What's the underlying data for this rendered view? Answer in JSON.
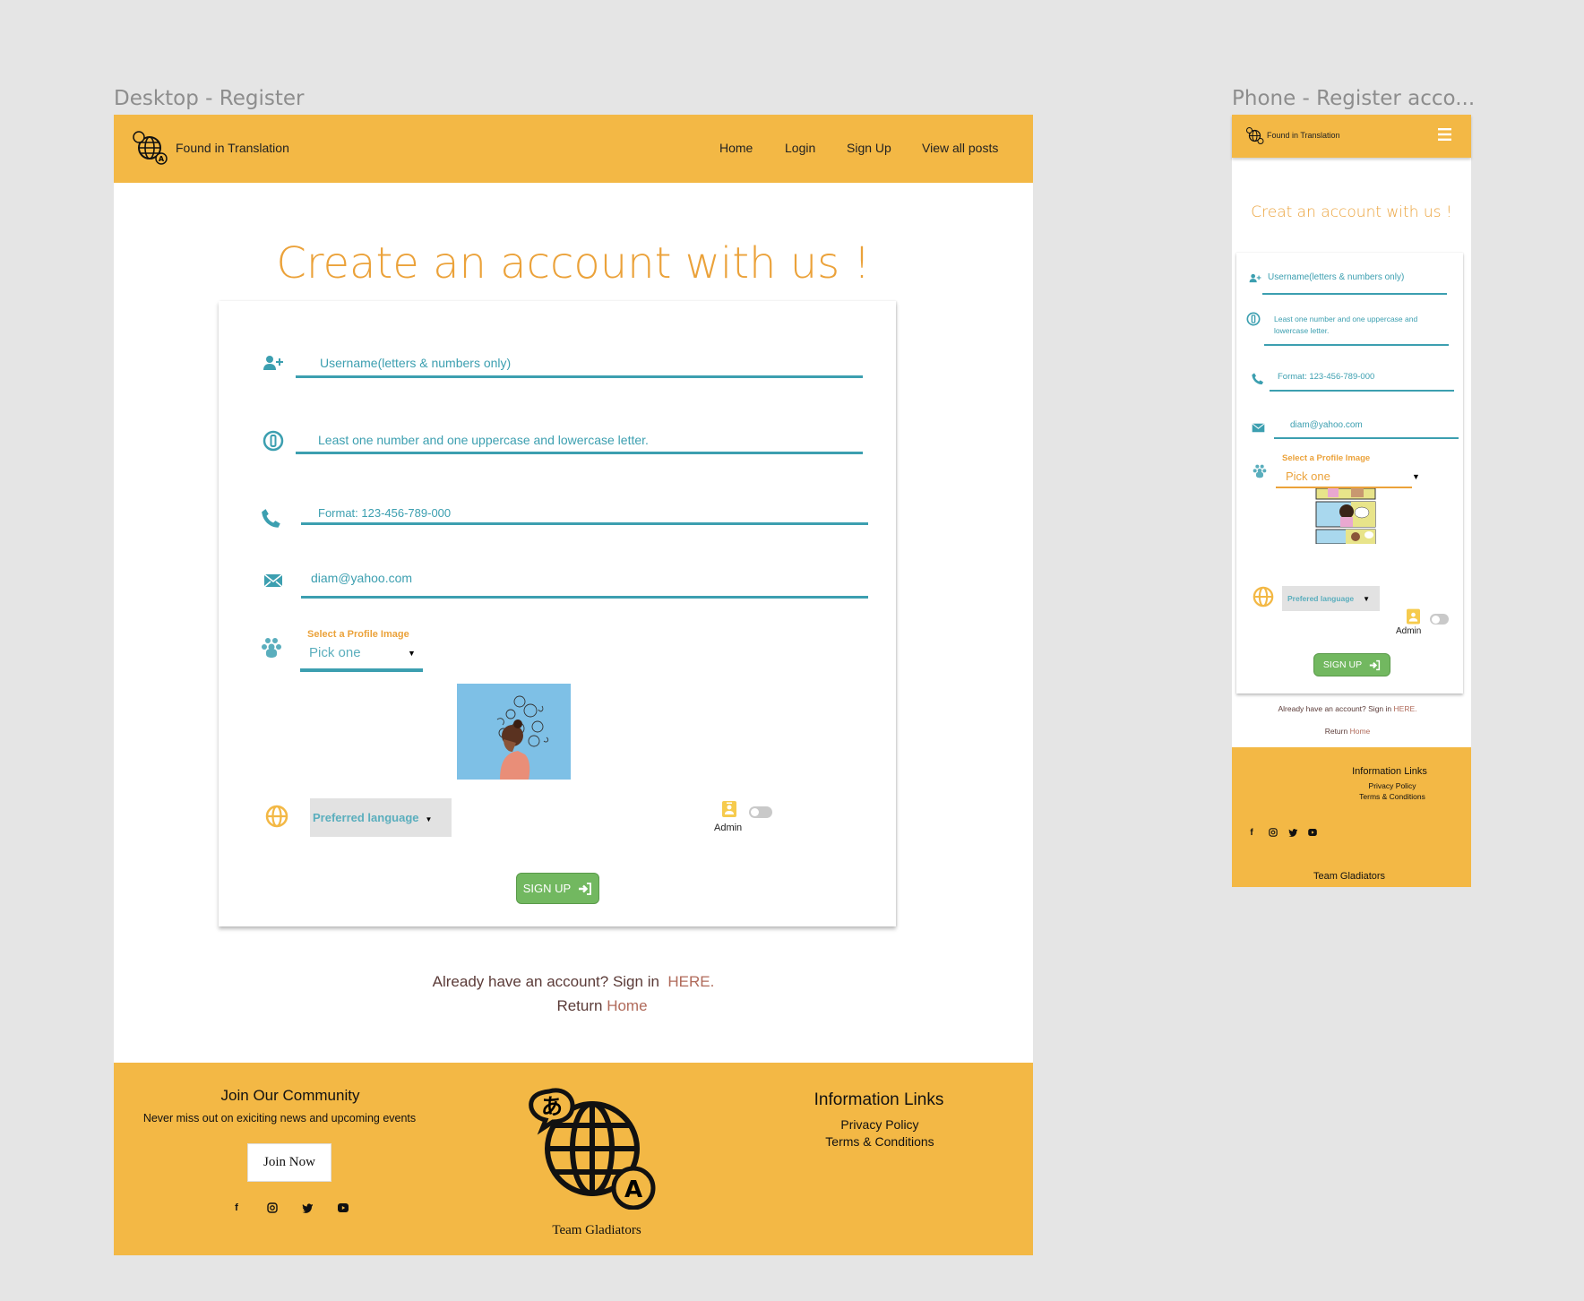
{
  "desktop": {
    "frame_label": "Desktop - Register",
    "header": {
      "brand": "Found in Translation",
      "nav": [
        "Home",
        "Login",
        "Sign Up",
        "View all posts"
      ]
    },
    "title": "Create an account with us !",
    "form": {
      "username_placeholder": "Username(letters & numbers only)",
      "password_placeholder": "Least one number and one uppercase and lowercase letter.",
      "phone_placeholder": "Format: 123-456-789-000",
      "email_value": "diam@yahoo.com",
      "profile_label": "Select a Profile Image",
      "profile_select": "Pick one",
      "language_select": "Preferred language",
      "admin_label": "Admin",
      "admin_enabled": false,
      "submit": "SIGN UP"
    },
    "signin_prompt": "Already have an account? Sign in",
    "signin_link": "HERE.",
    "return_text": "Return",
    "return_link": "Home",
    "footer": {
      "community_title": "Join Our Community",
      "community_sub": "Never miss out on exiciting news and upcoming events",
      "join_button": "Join Now",
      "team": "Team Gladiators",
      "info_title": "Information Links",
      "links": [
        "Privacy Policy",
        "Terms & Conditions"
      ],
      "social": [
        "facebook-icon",
        "instagram-icon",
        "twitter-icon",
        "youtube-icon"
      ]
    }
  },
  "phone": {
    "frame_label": "Phone - Register acco...",
    "header": {
      "brand": "Found in Translation"
    },
    "title": "Creat an account with us !",
    "form": {
      "username_placeholder": "Username(letters & numbers only)",
      "password_line1": "Least one number and one uppercase and",
      "password_line2": "lowercase letter.",
      "phone_placeholder": "Format: 123-456-789-000",
      "email_value": "diam@yahoo.com",
      "profile_label": "Select a Profile Image",
      "profile_select": "Pick one",
      "language_select": "Prefered language",
      "admin_label": "Admin",
      "admin_enabled": false,
      "submit": "SIGN UP"
    },
    "signin_prompt": "Already have an account? Sign in",
    "signin_link": "HERE.",
    "return_text": "Return",
    "return_link": "Home",
    "footer": {
      "info_title": "Information Links",
      "links": [
        "Privacy Policy",
        "Terms & Conditions"
      ],
      "team": "Team Gladiators"
    }
  },
  "colors": {
    "header": "#f3b845",
    "accent_orange": "#eba23a",
    "teal": "#3c9fb0",
    "button_green": "#72b860",
    "link": "#b06a5a"
  }
}
